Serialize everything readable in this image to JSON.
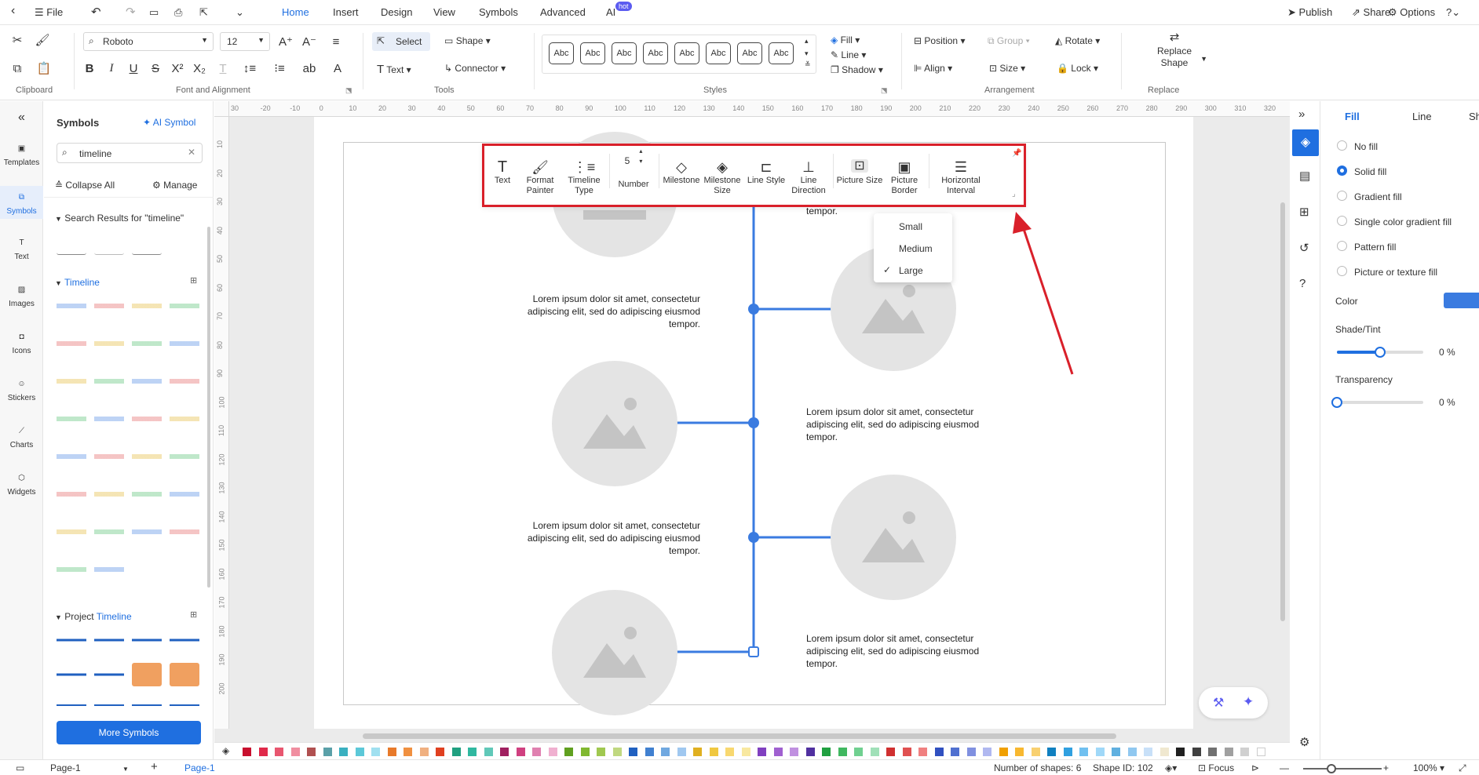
{
  "menu": {
    "file": "File",
    "tabs": [
      "Home",
      "Insert",
      "Design",
      "View",
      "Symbols",
      "Advanced",
      "AI"
    ],
    "hot_badge": "hot",
    "publish": "Publish",
    "share": "Share",
    "options": "Options"
  },
  "ribbon": {
    "font_name": "Roboto",
    "font_size": "12",
    "select": "Select",
    "shape": "Shape",
    "text": "Text",
    "connector": "Connector",
    "style_sample": "Abc",
    "fill": "Fill",
    "line": "Line",
    "shadow": "Shadow",
    "position": "Position",
    "group": "Group",
    "rotate": "Rotate",
    "align": "Align",
    "size": "Size",
    "lock": "Lock",
    "replace_shape": "Replace Shape",
    "groups": {
      "clipboard": "Clipboard",
      "font": "Font and Alignment",
      "tools": "Tools",
      "styles": "Styles",
      "arrangement": "Arrangement",
      "replace": "Replace"
    }
  },
  "leftnav": [
    "Templates",
    "Symbols",
    "Text",
    "Images",
    "Icons",
    "Stickers",
    "Charts",
    "Widgets"
  ],
  "symbols_panel": {
    "title": "Symbols",
    "ai_symbol": "AI Symbol",
    "search_value": "timeline",
    "collapse_all": "Collapse All",
    "manage": "Manage",
    "search_results_label": "Search Results for  \"timeline\"",
    "timeline_section": "Timeline",
    "project_prefix": "Project ",
    "project_highlight": "Timeline",
    "more_symbols": "More Symbols"
  },
  "ruler": {
    "h": [
      "30",
      "-20",
      "-10",
      "0",
      "10",
      "20",
      "30",
      "40",
      "50",
      "60",
      "70",
      "80",
      "90",
      "100",
      "110",
      "120",
      "130",
      "140",
      "150",
      "160",
      "170",
      "180",
      "190",
      "200",
      "210",
      "220",
      "230",
      "240",
      "250",
      "260",
      "270",
      "280",
      "290",
      "300",
      "310",
      "320"
    ],
    "v": [
      "10",
      "20",
      "30",
      "40",
      "50",
      "60",
      "70",
      "80",
      "90",
      "100",
      "110",
      "120",
      "130",
      "140",
      "150",
      "160",
      "170",
      "180",
      "190",
      "200"
    ]
  },
  "canvas": {
    "lorem_line1": "Lorem ipsum dolor sit amet, consectetur",
    "lorem_line2": "adipiscing elit, sed do adipiscing eiusmod",
    "lorem_line3": "tempor.",
    "lorem_top_fragment": "tempor."
  },
  "floating_toolbar": {
    "buttons": [
      "Text",
      "Format Painter",
      "Timeline Type",
      "Number",
      "Milestone",
      "Milestone Size",
      "Line Style",
      "Line Direction",
      "Picture Size",
      "Picture Border",
      "Horizontal Interval"
    ],
    "number_value": "5"
  },
  "picture_size_menu": {
    "options": [
      "Small",
      "Medium",
      "Large"
    ],
    "selected": "Large"
  },
  "right_panel": {
    "tabs": [
      "Fill",
      "Line",
      "Shac"
    ],
    "fill_options": [
      "No fill",
      "Solid fill",
      "Gradient fill",
      "Single color gradient fill",
      "Pattern fill",
      "Picture or texture fill"
    ],
    "selected_fill": "Solid fill",
    "color_label": "Color",
    "accent_color": "#3a7be0",
    "shade_label": "Shade/Tint",
    "shade_value": "0 %",
    "shade_level": 0.5,
    "transparency_label": "Transparency",
    "transparency_value": "0 %",
    "transparency_level": 0
  },
  "status": {
    "page_select": "Page-1",
    "page_tab": "Page-1",
    "shapes": "Number of shapes: 6",
    "shape_id": "Shape ID: 102",
    "focus": "Focus",
    "zoom": "100%"
  },
  "palette": [
    "#c8102e",
    "#e0294a",
    "#e8566f",
    "#f08ea0",
    "#b05050",
    "#5aa0a8",
    "#3ab0c0",
    "#5cc8d8",
    "#a0e0f0",
    "#e87a2a",
    "#f09040",
    "#f0b080",
    "#e04020",
    "#20a080",
    "#30b8a0",
    "#60c8b8",
    "#a02060",
    "#d04080",
    "#e080b0",
    "#f0b0d0",
    "#60a020",
    "#80b830",
    "#a0c850",
    "#c0d880",
    "#2060c0",
    "#4080d0",
    "#70a8e0",
    "#a0c8f0",
    "#e0b020",
    "#f0c840",
    "#f8d870",
    "#f8e8a0",
    "#8040c0",
    "#a060d0",
    "#c090e0",
    "#5030a0",
    "#20a040",
    "#40b860",
    "#70d090",
    "#a0e0b8",
    "#d03030",
    "#e05050",
    "#f08080",
    "#3050c0",
    "#5070d0",
    "#8090e0",
    "#b0b8f0",
    "#f0a000",
    "#f8b830",
    "#f8d070",
    "#1080c0",
    "#30a0e0",
    "#70c0f0",
    "#a0d8f8",
    "#60b0e0",
    "#90c8f0",
    "#c8e0f8",
    "#f0e8d0",
    "#202020",
    "#404040",
    "#707070",
    "#a0a0a0",
    "#d0d0d0",
    "#ffffff"
  ]
}
